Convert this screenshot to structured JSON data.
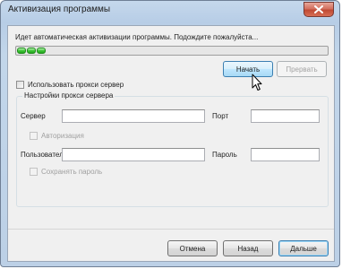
{
  "window": {
    "title": "Активизация программы"
  },
  "activation": {
    "status_text": "Идет автоматическая активизации программы. Подождите пожалуйста...",
    "progress_chunks": 3
  },
  "buttons": {
    "start": "Начать",
    "abort": "Прервать",
    "cancel": "Отмена",
    "back": "Назад",
    "next": "Дальше"
  },
  "proxy": {
    "use_proxy_label": "Использовать прокси сервер",
    "use_proxy_checked": false,
    "group_title": "Настройки прокси сервера",
    "server_label": "Сервер",
    "server_value": "",
    "port_label": "Порт",
    "port_value": "",
    "auth_label": "Авторизация",
    "auth_checked": false,
    "user_label": "Пользователь",
    "user_value": "",
    "password_label": "Пароль",
    "password_value": "",
    "save_password_label": "Сохранять пароль",
    "save_password_checked": false
  },
  "colors": {
    "progress_fill": "#3fc538",
    "hover_border": "#3c7fb1",
    "close_button": "#c04a34"
  }
}
